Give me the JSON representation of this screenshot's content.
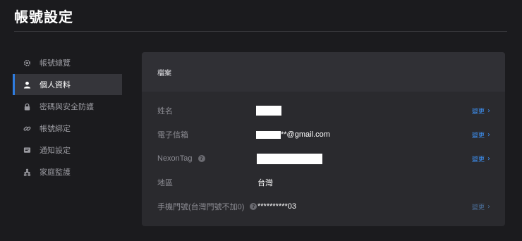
{
  "page": {
    "title": "帳號設定"
  },
  "sidebar": {
    "items": [
      {
        "label": "帳號總覽",
        "icon": "gear-icon",
        "active": false
      },
      {
        "label": "個人資料",
        "icon": "person-icon",
        "active": true
      },
      {
        "label": "密碼與安全防護",
        "icon": "lock-icon",
        "active": false
      },
      {
        "label": "帳號綁定",
        "icon": "link-icon",
        "active": false
      },
      {
        "label": "通知設定",
        "icon": "message-icon",
        "active": false
      },
      {
        "label": "家庭監護",
        "icon": "family-icon",
        "active": false
      }
    ]
  },
  "panel": {
    "header": "檔案",
    "rows": [
      {
        "label": "姓名",
        "value": "",
        "change": "變更"
      },
      {
        "label": "電子信箱",
        "value": "**@gmail.com",
        "change": "變更"
      },
      {
        "label": "NexonTag",
        "help": "?",
        "value": "",
        "change": "變更"
      },
      {
        "label": "地區",
        "value": "台灣"
      },
      {
        "label": "手機門號(台灣門號不加0)",
        "help": "?",
        "value": "**********03",
        "change": "變更"
      }
    ]
  },
  "colors": {
    "accent": "#2f7de1",
    "link": "#3d8ff0",
    "background": "#1b1b1e",
    "panel": "#2a2a2e"
  }
}
